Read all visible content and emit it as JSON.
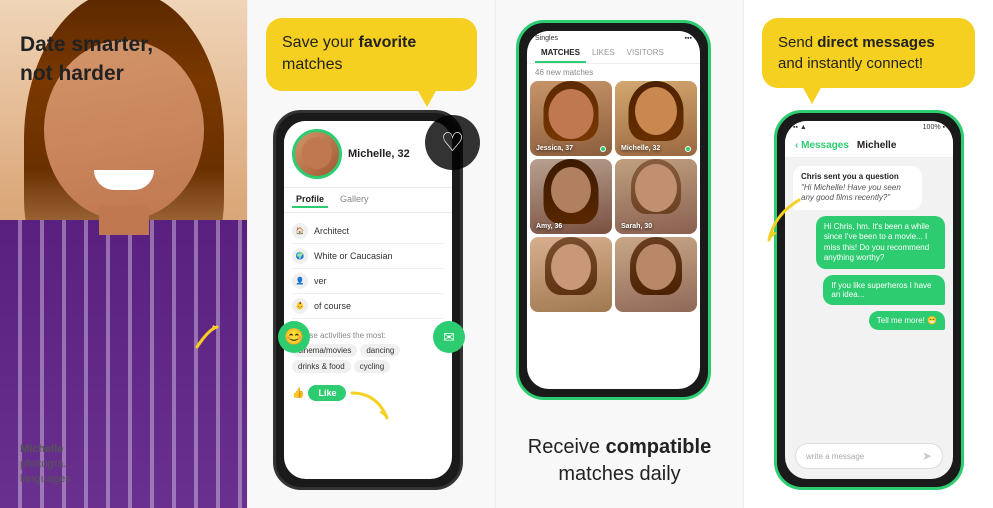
{
  "panel1": {
    "headline": "Date smarter,\nnot harder",
    "person_name": "Michelle",
    "info_rows": [
      {
        "label": "photographer"
      },
      {
        "label": "languages"
      }
    ]
  },
  "panel2": {
    "speech_bubble": "Save your favorite matches",
    "speech_bold": "favorite",
    "profile": {
      "name": "Michelle, 32",
      "tabs": [
        "Profile",
        "Gallery"
      ],
      "fields": [
        {
          "icon": "🏠",
          "text": "Architect"
        },
        {
          "icon": "🌍",
          "text": "White or Caucasian"
        },
        {
          "icon": "👤",
          "text": "ver"
        },
        {
          "icon": "👶",
          "text": "of course"
        }
      ],
      "activities_label": "s these activities the most:",
      "tags": [
        "cinema/movies",
        "dancing",
        "drinks & food",
        "cycling"
      ]
    },
    "like_btn": "Like"
  },
  "panel3": {
    "status_bar": "Singles",
    "tabs": [
      "MATCHES",
      "LIKES",
      "VISITORS"
    ],
    "new_matches": "46 new matches",
    "matches": [
      {
        "name": "Jessica, 37",
        "online": true
      },
      {
        "name": "Michelle, 32",
        "online": true
      },
      {
        "name": "Amy, 36",
        "online": false
      },
      {
        "name": "Sarah, 30",
        "online": false
      },
      {
        "name": "",
        "online": false
      },
      {
        "name": "",
        "online": false
      }
    ],
    "bottom_text_1": "Receive",
    "bottom_text_2": "compatible",
    "bottom_text_3": "matches daily"
  },
  "panel4": {
    "speech_bubble_line1": "Send direct messages",
    "speech_bubble_line2": "and instantly connect!",
    "speech_bold": "direct messages",
    "chat": {
      "header_back": "< Messages",
      "header_name": "Michelle",
      "status": "100%",
      "messages": [
        {
          "type": "question",
          "sender": "Chris sent you a question",
          "text": "\"Hi Michelle! Have you seen any good films recently?\""
        },
        {
          "type": "reply",
          "text": "Hi Chris, hm. It's been a while since I've been to a movie... I miss this! Do you recommend anything worthy?"
        },
        {
          "type": "reply",
          "text": "If you like superheros I have an idea..."
        },
        {
          "type": "reply",
          "text": "Tell me more! 😁"
        }
      ],
      "input_placeholder": "write a message"
    }
  }
}
